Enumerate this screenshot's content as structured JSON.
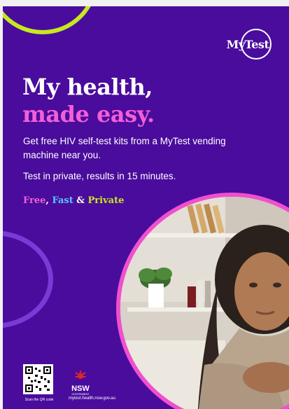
{
  "logo": {
    "text": "MyTest"
  },
  "headline": {
    "line1": "My health,",
    "line2": "made easy."
  },
  "body": {
    "paragraph1": "Get free HIV self-test kits from a MyTest vending machine near you.",
    "paragraph2": "Test in private, results in 15 minutes."
  },
  "tagline": {
    "word1": "Free",
    "sep1": ", ",
    "word2": "Fast",
    "sep2": " & ",
    "word3": "Private"
  },
  "footer": {
    "qr_caption": "Scan the QR code",
    "nsw_label": "NSW",
    "nsw_sub": "GOVERNMENT",
    "url": "mytest.health.nsw.gov.au"
  },
  "colors": {
    "background": "#4a0c9c",
    "pink": "#f45ed8",
    "blue": "#58c8ff",
    "lime": "#c6e81f"
  }
}
